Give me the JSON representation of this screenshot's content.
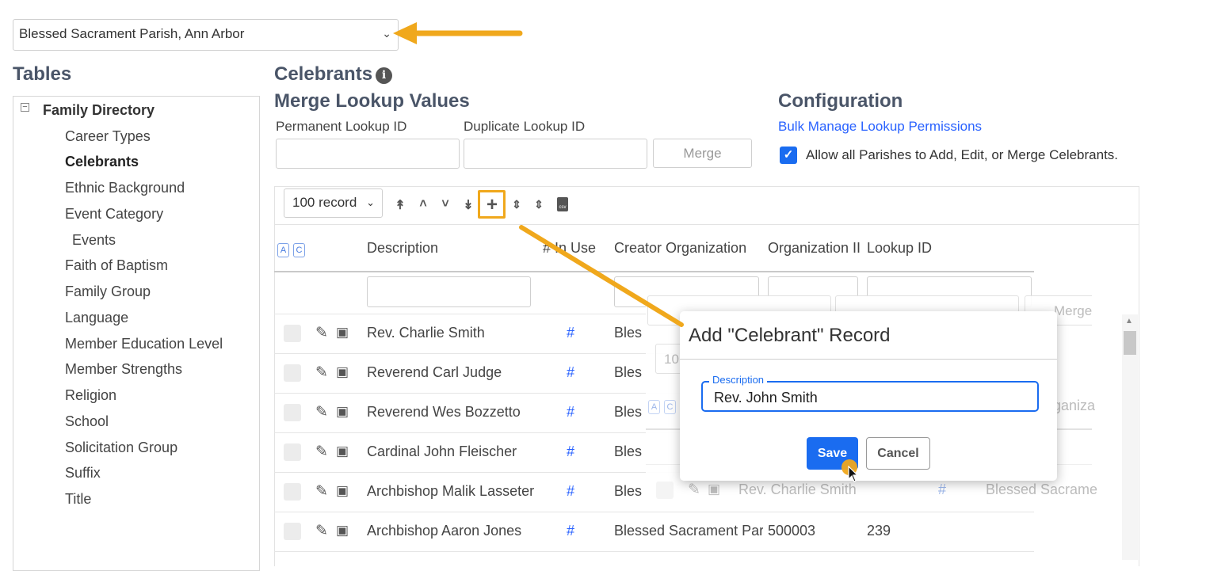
{
  "parish_selector": {
    "value": "Blessed Sacrament Parish, Ann Arbor"
  },
  "sidebar": {
    "title": "Tables",
    "root": "Family Directory",
    "items": [
      {
        "label": "Career Types"
      },
      {
        "label": "Celebrants"
      },
      {
        "label": "Ethnic Background"
      },
      {
        "label": "Event Category"
      },
      {
        "label": "Events"
      },
      {
        "label": "Faith of Baptism"
      },
      {
        "label": "Family Group"
      },
      {
        "label": "Language"
      },
      {
        "label": "Member Education Level"
      },
      {
        "label": "Member Strengths"
      },
      {
        "label": "Religion"
      },
      {
        "label": "School"
      },
      {
        "label": "Solicitation Group"
      },
      {
        "label": "Suffix"
      },
      {
        "label": "Title"
      }
    ]
  },
  "main": {
    "title": "Celebrants",
    "merge": {
      "title": "Merge Lookup Values",
      "permanent_label": "Permanent Lookup ID",
      "duplicate_label": "Duplicate Lookup ID",
      "button": "Merge"
    },
    "config": {
      "title": "Configuration",
      "link": "Bulk Manage Lookup Permissions",
      "checkbox_label": "Allow all Parishes to Add, Edit, or Merge Celebrants."
    },
    "grid": {
      "page_size": "100 record",
      "ac": [
        "A",
        "C"
      ],
      "columns": [
        "Description",
        "# In Use",
        "Creator Organization",
        "Organization II",
        "Lookup ID"
      ],
      "rows": [
        {
          "description": "Rev. Charlie Smith",
          "in_use": "#",
          "creator": "Bles",
          "org": "",
          "lookup": ""
        },
        {
          "description": "Reverend Carl Judge",
          "in_use": "#",
          "creator": "Bles",
          "org": "",
          "lookup": ""
        },
        {
          "description": "Reverend Wes Bozzetto",
          "in_use": "#",
          "creator": "Bles",
          "org": "",
          "lookup": ""
        },
        {
          "description": "Cardinal John Fleischer",
          "in_use": "#",
          "creator": "Bles",
          "org": "",
          "lookup": ""
        },
        {
          "description": "Archbishop Malik Lasseter",
          "in_use": "#",
          "creator": "Bles",
          "org": "",
          "lookup": ""
        },
        {
          "description": "Archbishop Aaron Jones",
          "in_use": "#",
          "creator": "Blessed Sacrament Par",
          "org": "500003",
          "lookup": "239"
        }
      ]
    },
    "ghost": {
      "merge": "Merge",
      "pager": "10",
      "ac": [
        "A",
        "C"
      ],
      "org_header": "rganiza",
      "row_description": "Rev. Charlie Smith",
      "row_hash": "#",
      "row_creator": "Blessed Sacrame"
    }
  },
  "modal": {
    "title": "Add \"Celebrant\" Record",
    "field_label": "Description",
    "field_value": "Rev. John Smith",
    "save": "Save",
    "cancel": "Cancel"
  },
  "colors": {
    "accent": "#1a6cf0",
    "annotation": "#f0a81c",
    "link": "#2962ff"
  },
  "icons": [
    "chevron-down-icon",
    "info-icon",
    "minus-box-icon",
    "double-up-icon",
    "up-icon",
    "down-icon",
    "double-down-icon",
    "plus-icon",
    "sort-icon",
    "csv-file-icon",
    "pencil-icon",
    "picture-icon",
    "check-icon",
    "cursor-icon"
  ]
}
